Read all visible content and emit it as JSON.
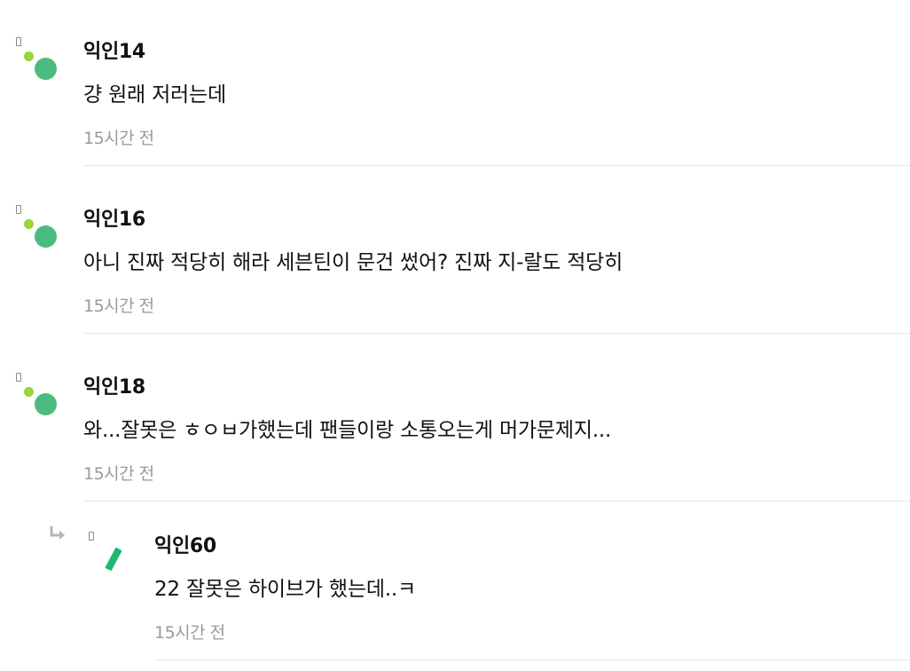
{
  "comments": [
    {
      "author": "익인14",
      "content": "걍 원래 저러는데",
      "time": "15시간 전"
    },
    {
      "author": "익인16",
      "content": "아니 진짜 적당히 해라 세븐틴이 문건 썼어? 진짜 지-랄도 적당히",
      "time": "15시간 전"
    },
    {
      "author": "익인18",
      "content": "와...잘못은 ㅎㅇㅂ가했는데 팬들이랑 소통오는게 머가문제지...",
      "time": "15시간 전"
    }
  ],
  "reply": {
    "author": "익인60",
    "content": "22 잘못은 하이브가 했는데..ㅋ",
    "time": "15시간 전"
  },
  "colors": {
    "avatar_small_dot": "#9ad43a",
    "avatar_big_dot": "#4cbb7f",
    "reply_stick": "#1db970",
    "time_text": "#9a9a9a",
    "divider": "#e6e6e6"
  }
}
